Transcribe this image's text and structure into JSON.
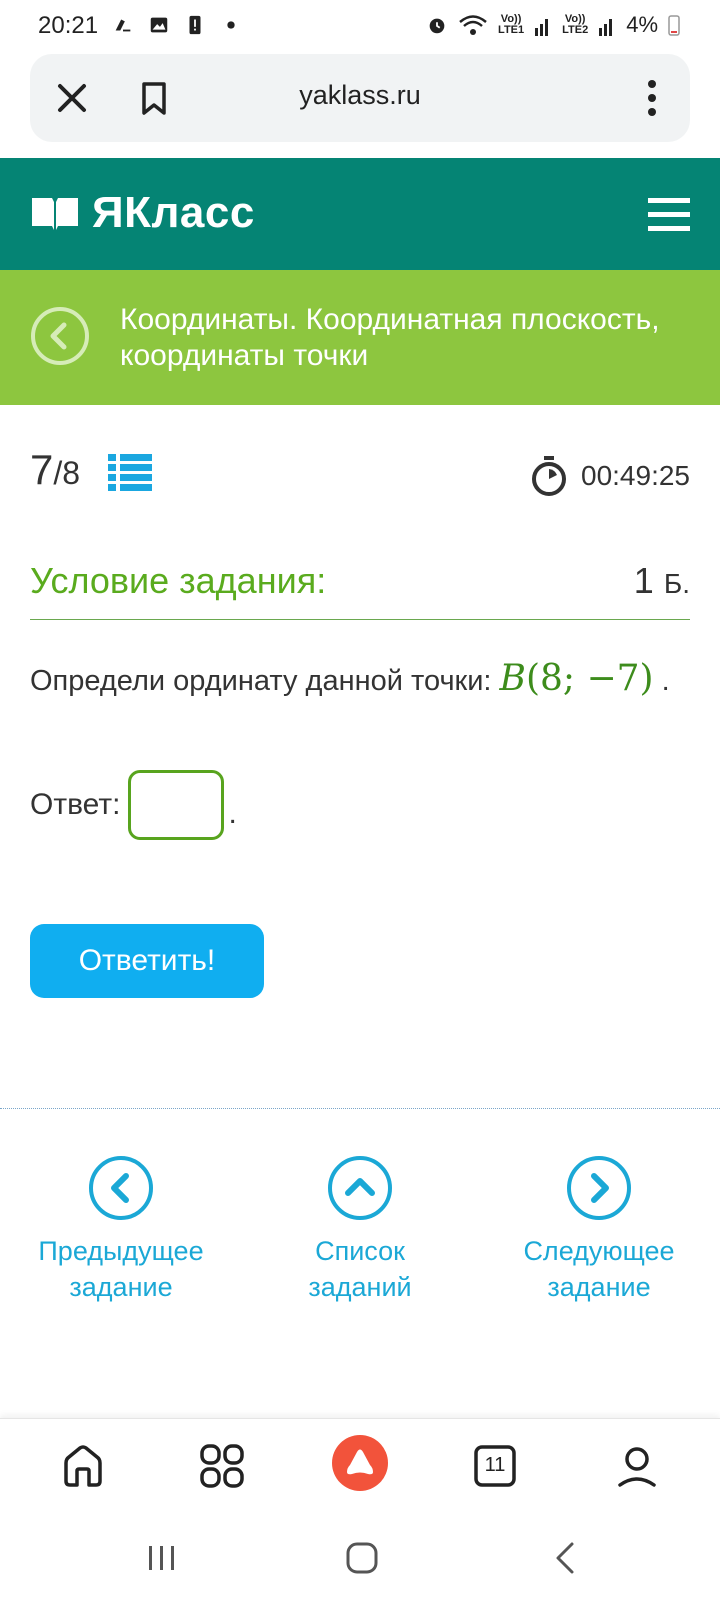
{
  "status_bar": {
    "time": "20:21",
    "battery": "4%",
    "icons": [
      "call-icon",
      "gallery-icon",
      "alert-icon",
      "dot-icon",
      "alarm-icon",
      "wifi-icon",
      "lte1-signal-icon",
      "lte2-signal-icon",
      "battery-icon"
    ],
    "lte1": "LTE1",
    "lte2": "LTE2",
    "vo": "Vo))"
  },
  "browser": {
    "url": "yaklass.ru"
  },
  "site": {
    "logo_text": "ЯКласс",
    "brand_color": "#058474"
  },
  "topic": {
    "title": "Координаты. Координатная плоскость, координаты точки",
    "color": "#8dc63f"
  },
  "task": {
    "current": "7",
    "total": "/8",
    "timer": "00:49:25",
    "condition_title": "Условие задания:",
    "points": "1",
    "points_unit": "Б.",
    "question_text": "Определи ординату данной точки:",
    "point_name": "B",
    "point_coords": "(8; −7)",
    "question_end": ".",
    "answer_label": "Ответ:",
    "answer_value": "",
    "answer_end": ".",
    "submit_label": "Ответить!"
  },
  "navigation": {
    "prev_line1": "Предыдущее",
    "prev_line2": "задание",
    "list_line1": "Список",
    "list_line2": "заданий",
    "next_line1": "Следующее",
    "next_line2": "задание"
  },
  "browser_bottom": {
    "tabs_count": "11"
  },
  "colors": {
    "accent_blue": "#10aef0",
    "link_blue": "#1ba8d6",
    "condition_green": "#5aab1e",
    "alice_red": "#f2533b"
  }
}
